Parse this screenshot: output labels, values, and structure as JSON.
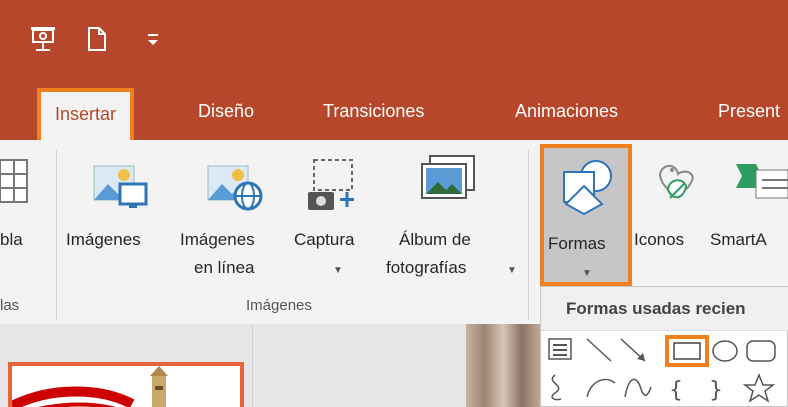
{
  "tabs": {
    "insertar": "Insertar",
    "diseno": "Diseño",
    "transiciones": "Transiciones",
    "animaciones": "Animaciones",
    "presentacion_partial": "Present"
  },
  "ribbon": {
    "tabla_partial": "bla",
    "imagenes": "Imágenes",
    "imagenes_en_linea_1": "Imágenes",
    "imagenes_en_linea_2": "en línea",
    "captura": "Captura",
    "album_1": "Álbum de",
    "album_2": "fotografías",
    "formas": "Formas",
    "iconos": "Iconos",
    "smartart_partial": "SmartA",
    "group_tablas_partial": "las",
    "group_imagenes": "Imágenes"
  },
  "dropdown": {
    "title": "Formas usadas recien"
  },
  "colors": {
    "accent": "#b7472a",
    "highlight": "#f07f1f"
  }
}
